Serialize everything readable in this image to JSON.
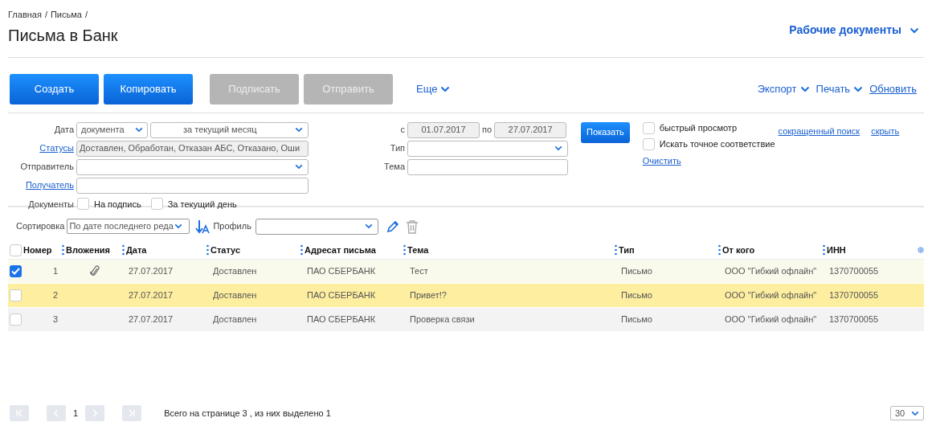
{
  "breadcrumbs": [
    {
      "label": "Главная"
    },
    {
      "label": "Письма"
    }
  ],
  "breadcrumb_separator": "/",
  "title": "Письма в Банк",
  "workspace_menu": {
    "label": "Рабочие документы"
  },
  "toolbar": [
    {
      "label": "Создать",
      "disabled": false
    },
    {
      "label": "Копировать",
      "disabled": false
    },
    {
      "label": "Подписать",
      "disabled": true
    },
    {
      "label": "Отправить",
      "disabled": true
    }
  ],
  "more_menu": {
    "label": "Еще"
  },
  "right_actions": [
    {
      "label": "Экспорт",
      "kind": "menu"
    },
    {
      "label": "Печать",
      "kind": "menu"
    },
    {
      "label": "Обновить",
      "kind": "link"
    }
  ],
  "filters": {
    "date": {
      "label": "Дата",
      "type_value": "документа",
      "period_value": "за текущий месяц"
    },
    "statuses": {
      "label": "Статусы",
      "value": "Доставлен, Обработан, Отказан АБС, Отказано, Оши"
    },
    "sender": {
      "label": "Отправитель"
    },
    "recipient": {
      "label": "Получатель"
    },
    "documents": {
      "label": "Документы",
      "options": [
        {
          "label": "На подпись",
          "checked": false
        },
        {
          "label": "За текущий день",
          "checked": false
        }
      ]
    },
    "from": {
      "label": "с",
      "value": "01.07.2017"
    },
    "to": {
      "label": "по",
      "value": "27.07.2017"
    },
    "type": {
      "label": "Тип"
    },
    "subject": {
      "label": "Тема"
    },
    "show_button": "Показать",
    "options": [
      {
        "label": "быстрый просмотр",
        "checked": false
      },
      {
        "label": "Искать точное соответствие",
        "checked": false
      }
    ],
    "clear_link": "Очистить",
    "short_search_link": "сокращенный поиск",
    "hide_link": "скрыть"
  },
  "sorting": {
    "label": "Сортировка",
    "value": "По дате последнего реда",
    "profile_label": "Профиль"
  },
  "table": {
    "columns": [
      "Номер",
      "Вложения",
      "Дата",
      "Статус",
      "Адресат письма",
      "Тема",
      "Тип",
      "От кого",
      "ИНН"
    ],
    "all_checked": false,
    "rows": [
      {
        "checked": true,
        "highlighted": false,
        "attachment": true,
        "cells": [
          "1",
          "",
          "27.07.2017",
          "Доставлен",
          "ПАО СБЕРБАНК",
          "Тест",
          "Письмо",
          "ООО \"Гибкий офлайн\"",
          "1370700055"
        ]
      },
      {
        "checked": false,
        "highlighted": true,
        "attachment": false,
        "cells": [
          "2",
          "",
          "27.07.2017",
          "Доставлен",
          "ПАО СБЕРБАНК",
          "Привет!?",
          "Письмо",
          "ООО \"Гибкий офлайн\"",
          "1370700055"
        ]
      },
      {
        "checked": false,
        "highlighted": false,
        "attachment": false,
        "cells": [
          "3",
          "",
          "27.07.2017",
          "Доставлен",
          "ПАО СБЕРБАНК",
          "Проверка связи",
          "Письмо",
          "ООО \"Гибкий офлайн\"",
          "1370700055"
        ]
      }
    ]
  },
  "pagination": {
    "page": "1",
    "summary": "Всего на странице 3 , из них выделено 1",
    "page_size": "30"
  }
}
